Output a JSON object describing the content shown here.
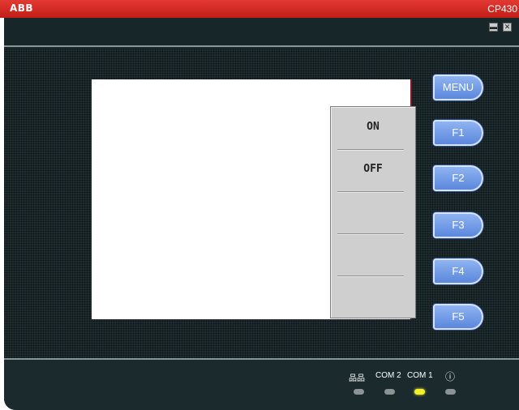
{
  "titlebar": {
    "brand": "ABB",
    "model": "CP430"
  },
  "window_controls": {
    "minimize_icon": "minimize-icon",
    "close_icon": "close-icon"
  },
  "popup": {
    "items": [
      "ON",
      "OFF",
      "",
      "",
      ""
    ]
  },
  "function_keys": [
    "MENU",
    "F1",
    "F2",
    "F3",
    "F4",
    "F5"
  ],
  "status": {
    "labels": [
      "品品",
      "COM 2",
      "COM 1",
      "ⓘ"
    ],
    "leds": [
      {
        "name": "network-led",
        "state": "off"
      },
      {
        "name": "com2-led",
        "state": "off"
      },
      {
        "name": "com1-led",
        "state": "on",
        "color": "#f3ef2c"
      },
      {
        "name": "power-led",
        "state": "off"
      }
    ]
  },
  "colors": {
    "titlebar": "#d32a24",
    "device": "#1b2b2d",
    "fkey": "#6f98e6",
    "led_on": "#f3ef2c"
  }
}
